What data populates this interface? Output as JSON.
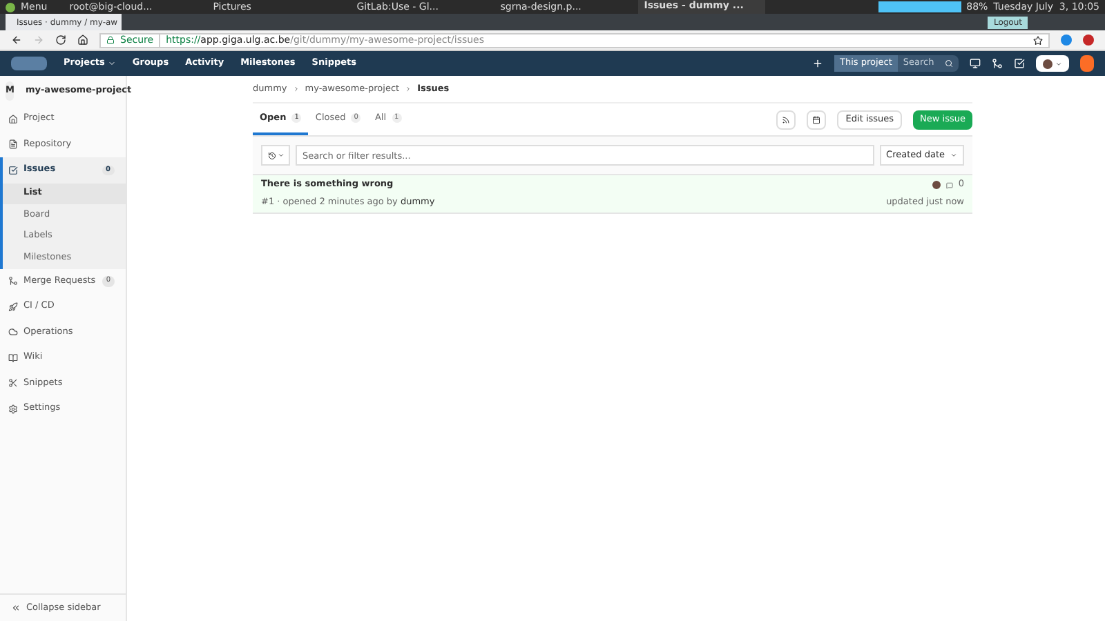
{
  "taskbar": {
    "menu": "Menu",
    "windows": [
      {
        "label": "root@big-cloud...",
        "selected": false
      },
      {
        "label": "Pictures",
        "selected": false
      },
      {
        "label": "GitLab:Use - Gl...",
        "selected": false
      },
      {
        "label": "sgrna-design.p...",
        "selected": false
      },
      {
        "label": "Issues - dummy ...",
        "selected": true
      }
    ],
    "battery": "88%",
    "clock": "Tuesday July  3, 10:05",
    "logout": "Logout"
  },
  "browser": {
    "tab_title": "Issues · dummy / my-aw",
    "secure": "Secure",
    "url_scheme": "https://",
    "url_host": "app.giga.ulg.ac.be",
    "url_path": "/git/dummy/my-awesome-project/issues"
  },
  "navbar": {
    "items": [
      "Projects",
      "Groups",
      "Activity",
      "Milestones",
      "Snippets"
    ],
    "search_scope": "This project",
    "search_placeholder": "Search"
  },
  "sidebar": {
    "avatar": "M",
    "project": "my-awesome-project",
    "items": [
      {
        "label": "Project",
        "selected": false
      },
      {
        "label": "Repository",
        "selected": false
      },
      {
        "label": "Issues",
        "count": "0",
        "selected": true,
        "children": [
          {
            "label": "List",
            "selected": true
          },
          {
            "label": "Board",
            "selected": false
          },
          {
            "label": "Labels",
            "selected": false
          },
          {
            "label": "Milestones",
            "selected": false
          }
        ]
      },
      {
        "label": "Merge Requests",
        "count": "0",
        "selected": false
      },
      {
        "label": "CI / CD",
        "selected": false
      },
      {
        "label": "Operations",
        "selected": false
      },
      {
        "label": "Wiki",
        "selected": false
      },
      {
        "label": "Snippets",
        "selected": false
      },
      {
        "label": "Settings",
        "selected": false
      }
    ],
    "collapse": "Collapse sidebar"
  },
  "breadcrumb": [
    "dummy",
    "my-awesome-project",
    "Issues"
  ],
  "tabs": [
    {
      "label": "Open",
      "count": "1",
      "selected": true
    },
    {
      "label": "Closed",
      "count": "0",
      "selected": false
    },
    {
      "label": "All",
      "count": "1",
      "selected": false
    }
  ],
  "buttons": {
    "edit": "Edit issues",
    "new": "New issue"
  },
  "filter": {
    "placeholder": "Search or filter results...",
    "sort": "Created date"
  },
  "issues": [
    {
      "title": "There is something wrong",
      "meta": "#1 · opened 2 minutes ago by",
      "author": "dummy",
      "comments": "0",
      "updated": "updated just now"
    }
  ]
}
